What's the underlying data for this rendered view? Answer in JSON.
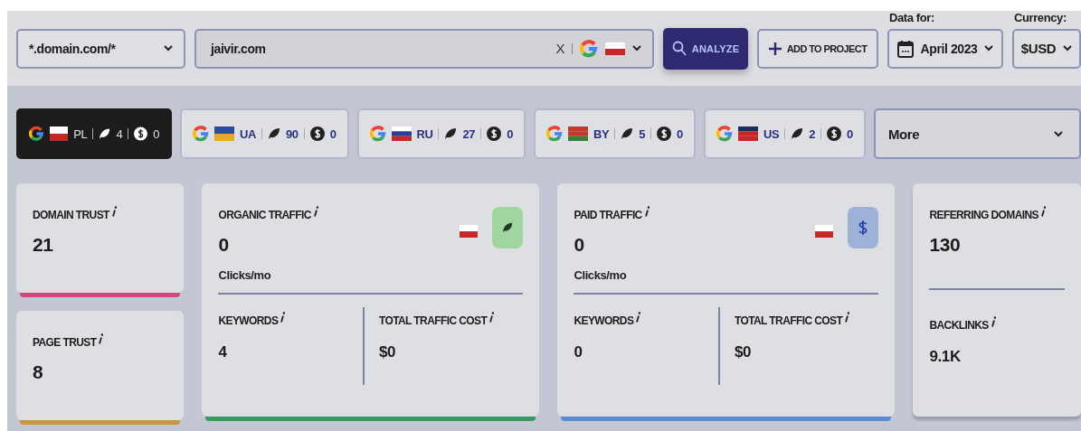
{
  "scope_select": {
    "value": "*.domain.com/*"
  },
  "search": {
    "value": "jaivir.com",
    "clear": "X"
  },
  "analyze_button": "ANALYZE",
  "add_button": "ADD TO PROJECT",
  "date": {
    "label": "Data for:",
    "value": "April 2023"
  },
  "currency": {
    "label": "Currency:",
    "value": "$USD"
  },
  "country_tabs": [
    {
      "code": "PL",
      "organic": "4",
      "paid": "0",
      "selected": true
    },
    {
      "code": "UA",
      "organic": "90",
      "paid": "0",
      "selected": false
    },
    {
      "code": "RU",
      "organic": "27",
      "paid": "0",
      "selected": false
    },
    {
      "code": "BY",
      "organic": "5",
      "paid": "0",
      "selected": false
    },
    {
      "code": "US",
      "organic": "2",
      "paid": "0",
      "selected": false
    }
  ],
  "more": "More",
  "trust_cards": [
    {
      "title": "DOMAIN TRUST",
      "value": "21",
      "color": "#d24a78"
    },
    {
      "title": "PAGE TRUST",
      "value": "8",
      "color": "#c8973a"
    }
  ],
  "traffic_cards": [
    {
      "kind": "organic",
      "title": "ORGANIC TRAFFIC",
      "value": "0",
      "unit": "Clicks/mo",
      "color": "#3a9a63",
      "metrics": [
        {
          "title": "KEYWORDS",
          "value": "4"
        },
        {
          "title": "TOTAL TRAFFIC COST",
          "value": "$0"
        }
      ]
    },
    {
      "kind": "paid",
      "title": "PAID TRAFFIC",
      "value": "0",
      "unit": "Clicks/mo",
      "color": "#5b8ad0",
      "metrics": [
        {
          "title": "KEYWORDS",
          "value": "0"
        },
        {
          "title": "TOTAL TRAFFIC COST",
          "value": "$0"
        }
      ]
    }
  ],
  "links_card": {
    "metrics": [
      {
        "title": "REFERRING DOMAINS",
        "value": "130"
      },
      {
        "title": "BACKLINKS",
        "value": "9.1K"
      }
    ]
  }
}
